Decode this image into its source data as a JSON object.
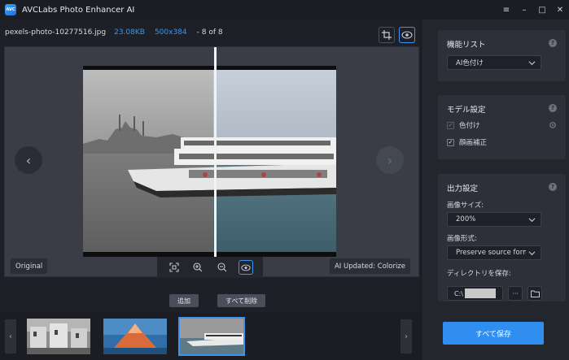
{
  "app": {
    "logo": "AVC",
    "title": "AVCLabs Photo Enhancer AI"
  },
  "window_controls": {
    "menu_icon": "≡",
    "minimize_icon": "–",
    "maximize_icon": "□",
    "close_icon": "✕"
  },
  "file_info": {
    "name": "pexels-photo-10277516.jpg",
    "size": "23.08KB",
    "dimensions": "500x384",
    "count": "- 8 of 8"
  },
  "viewer": {
    "left_tag": "Original",
    "right_tag": "AI Updated: Colorize",
    "prev_icon": "‹",
    "next_icon": "›"
  },
  "actions": {
    "add": "追加",
    "delete_all": "すべて削除"
  },
  "thumbstrip": {
    "prev_icon": "‹",
    "next_icon": "›"
  },
  "feature_list": {
    "title": "機能リスト",
    "help": "?",
    "selected": "AI色付け"
  },
  "model_settings": {
    "title": "モデル設定",
    "help": "?",
    "items": [
      {
        "label": "色付け",
        "checked": true
      },
      {
        "label": "顔画補正",
        "checked": true
      }
    ]
  },
  "output_settings": {
    "title": "出力設定",
    "help": "?",
    "size_label": "画像サイズ:",
    "size_value": "200%",
    "format_label": "画像形式:",
    "format_value": "Preserve source forma",
    "dir_label": "ディレクトリを保存:",
    "dir_value": "C:\\",
    "browse_icon": "···"
  },
  "save_all": "すべて保存",
  "colors": {
    "accent": "#2f8ef0",
    "panel": "#2d3038",
    "background": "#1e2027"
  }
}
